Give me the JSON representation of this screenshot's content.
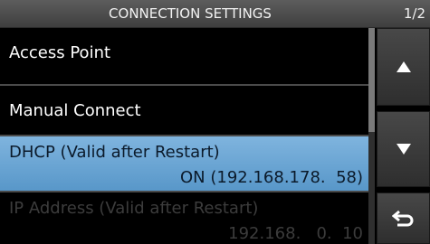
{
  "header": {
    "title": "CONNECTION SETTINGS",
    "page": "1/2"
  },
  "items": [
    {
      "label": "Access Point"
    },
    {
      "label": "Manual Connect"
    },
    {
      "label": "DHCP (Valid after Restart)",
      "value": "ON (192.168.178.  58)"
    },
    {
      "label": "IP Address (Valid after Restart)",
      "value": "192.168.   0.  10"
    }
  ],
  "buttons": {
    "up_icon": "triangle-up-icon",
    "down_icon": "triangle-down-icon",
    "back_icon": "return-arrow-icon"
  },
  "colors": {
    "selected": "#6ca6d4",
    "header": "#4a4a4a",
    "background": "#000000"
  }
}
